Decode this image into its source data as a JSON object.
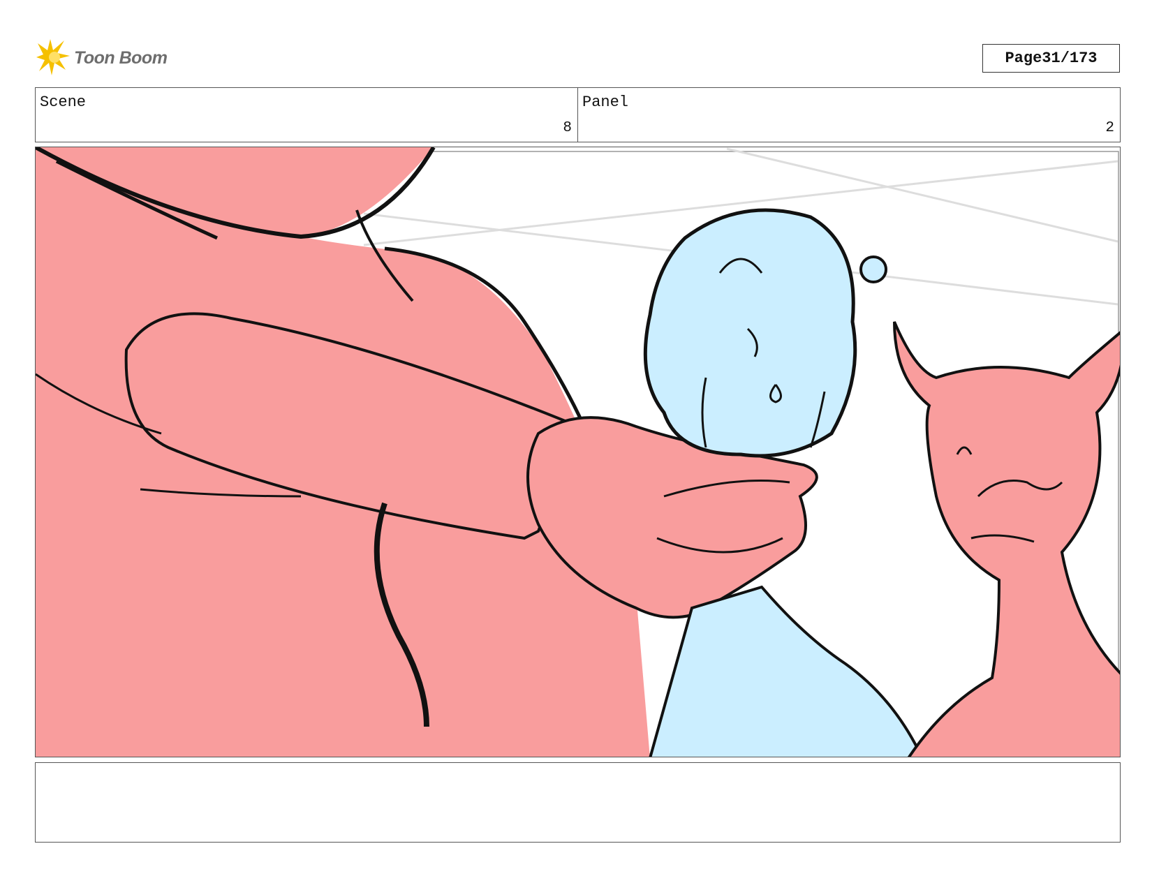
{
  "header": {
    "logo_text": "Toon Boom",
    "logo_icon": "starburst-logo-icon",
    "page_label": "Page",
    "page_value": "31/173"
  },
  "info": {
    "scene_label": "Scene",
    "scene_value": "8",
    "panel_label": "Panel",
    "panel_value": "2"
  },
  "colors": {
    "red_fill": "#f99d9d",
    "blue_fill": "#cbeeff",
    "logo_yellow": "#f5c000",
    "logo_text": "#6d6d6d"
  },
  "notes": {
    "text": ""
  }
}
